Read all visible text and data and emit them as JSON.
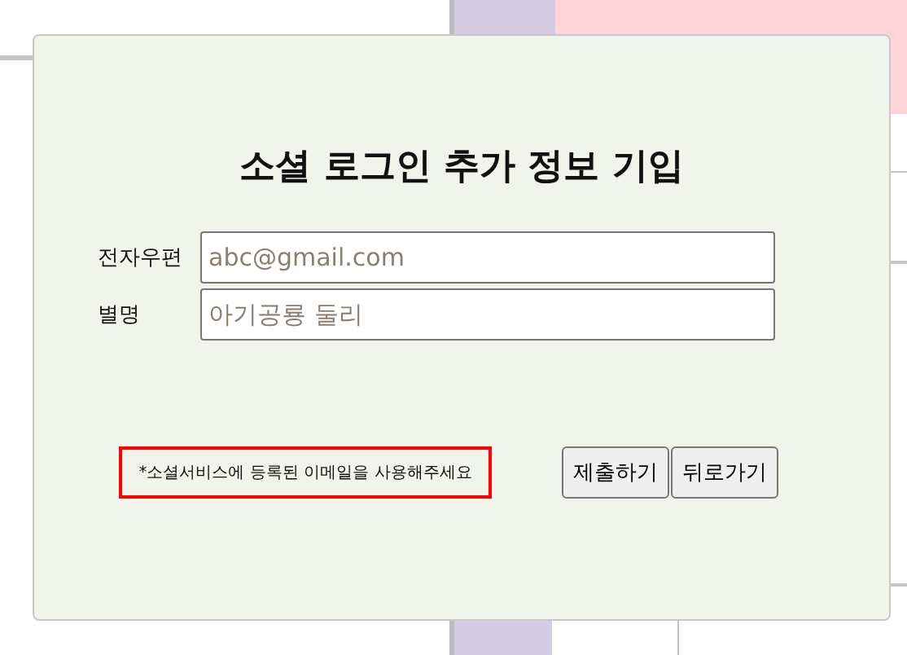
{
  "dialog": {
    "title": "소셜 로그인 추가 정보 기입",
    "fields": [
      {
        "label": "전자우편",
        "placeholder": "abc@gmail.com"
      },
      {
        "label": "별명",
        "placeholder": "아기공룡 둘리"
      }
    ],
    "notice": "*소셜서비스에 등록된 이메일을 사용해주세요",
    "buttons": [
      "제출하기",
      "뒤로가기"
    ]
  }
}
